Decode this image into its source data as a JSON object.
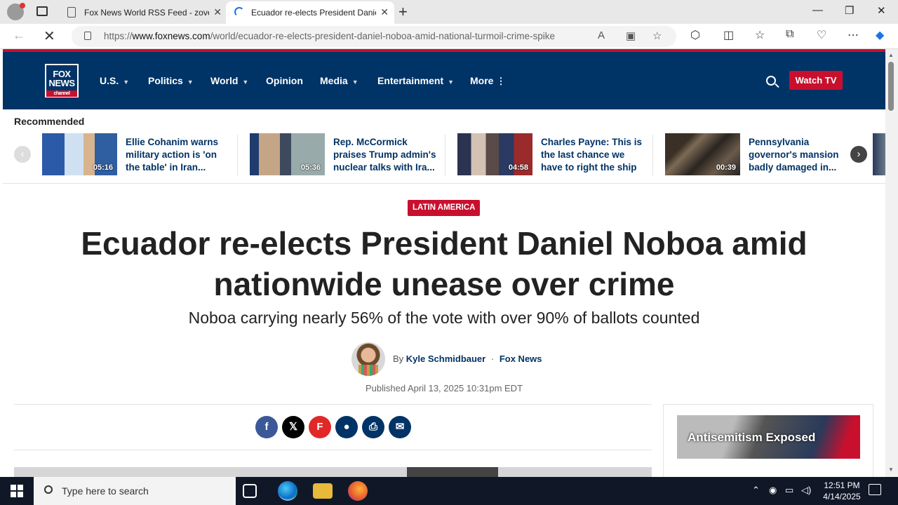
{
  "browser": {
    "tabs": [
      {
        "title": "Fox News World RSS Feed - zove",
        "close": "✕"
      },
      {
        "title": "Ecuador re-elects President Danie",
        "close": "✕"
      }
    ],
    "new_tab": "+",
    "window_controls": {
      "minimize": "—",
      "restore": "❐",
      "close": "✕"
    },
    "url_prefix": "https://",
    "url_host": "www.foxnews.com",
    "url_path": "/world/ecuador-re-elects-president-daniel-noboa-amid-national-turmoil-crime-spike"
  },
  "site": {
    "logo_top": "FOX",
    "logo_mid": "NEWS",
    "logo_bottom": "channel",
    "nav": [
      {
        "label": "U.S.",
        "caret": "▼"
      },
      {
        "label": "Politics",
        "caret": "▼"
      },
      {
        "label": "World",
        "caret": "▼"
      },
      {
        "label": "Opinion",
        "caret": ""
      },
      {
        "label": "Media",
        "caret": "▼"
      },
      {
        "label": "Entertainment",
        "caret": "▼"
      },
      {
        "label": "More",
        "caret": "⋮"
      }
    ],
    "watch_tv": "Watch TV",
    "brand_colors": {
      "navy": "#003366",
      "red": "#c8102e"
    }
  },
  "recommended": {
    "title": "Recommended",
    "items": [
      {
        "text": "Ellie Cohanim warns military action is 'on the table' in Iran...",
        "duration": "05:16"
      },
      {
        "text": "Rep. McCormick praises Trump admin's nuclear talks with Ira...",
        "duration": "05:36"
      },
      {
        "text": "Charles Payne: This is the last chance we have to right the ship",
        "duration": "04:58"
      },
      {
        "text": "Pennsylvania governor's mansion badly damaged in...",
        "duration": "00:39"
      }
    ]
  },
  "article": {
    "kicker": "LATIN AMERICA",
    "headline": "Ecuador re-elects President Daniel Noboa amid nationwide unease over crime",
    "subhead": "Noboa carrying nearly 56% of the vote with over 90% of ballots counted",
    "by": "By",
    "author": "Kyle Schmidbauer",
    "dot": "·",
    "outlet": "Fox News",
    "published": "Published April 13, 2025 10:31pm EDT"
  },
  "share": [
    {
      "name": "facebook-share-button",
      "glyph": "f",
      "color": "#3b5998"
    },
    {
      "name": "x-share-button",
      "glyph": "𝕏",
      "color": "#000000"
    },
    {
      "name": "flipboard-share-button",
      "glyph": "F",
      "color": "#e12828"
    },
    {
      "name": "comments-button",
      "glyph": "●",
      "color": "#003366"
    },
    {
      "name": "print-button",
      "glyph": "⎙",
      "color": "#003366"
    },
    {
      "name": "email-share-button",
      "glyph": "✉",
      "color": "#003366"
    }
  ],
  "ad": {
    "text": "Antisemitism Exposed"
  },
  "taskbar": {
    "search_placeholder": "Type here to search",
    "time": "12:51 PM",
    "date": "4/14/2025"
  }
}
